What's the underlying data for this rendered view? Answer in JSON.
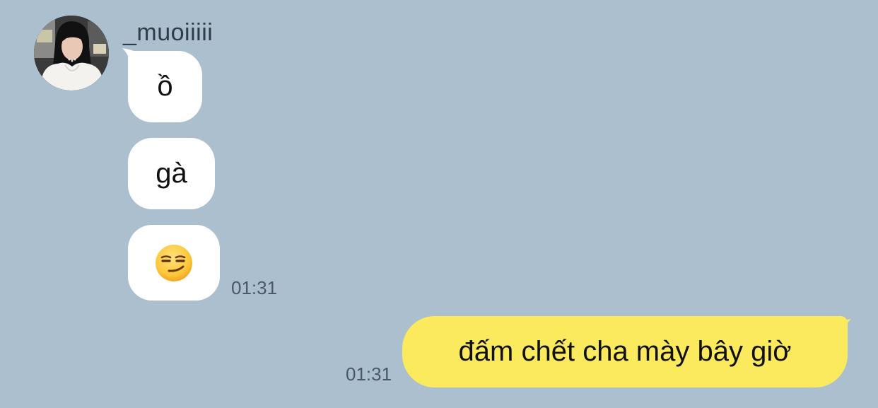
{
  "chat": {
    "background_color": "#abbfcf",
    "incoming": {
      "sender_name": "_muoiiiii",
      "avatar_icon": "profile-photo",
      "messages": [
        {
          "text": "ồ"
        },
        {
          "text": "gà"
        },
        {
          "text": "",
          "emoji": "smirking-face-emoji"
        }
      ],
      "time": "01:31",
      "bubble_color": "#ffffff"
    },
    "outgoing": {
      "messages": [
        {
          "text": "đấm chết cha mày bây giờ"
        }
      ],
      "time": "01:31",
      "bubble_color": "#fbea5e"
    }
  }
}
